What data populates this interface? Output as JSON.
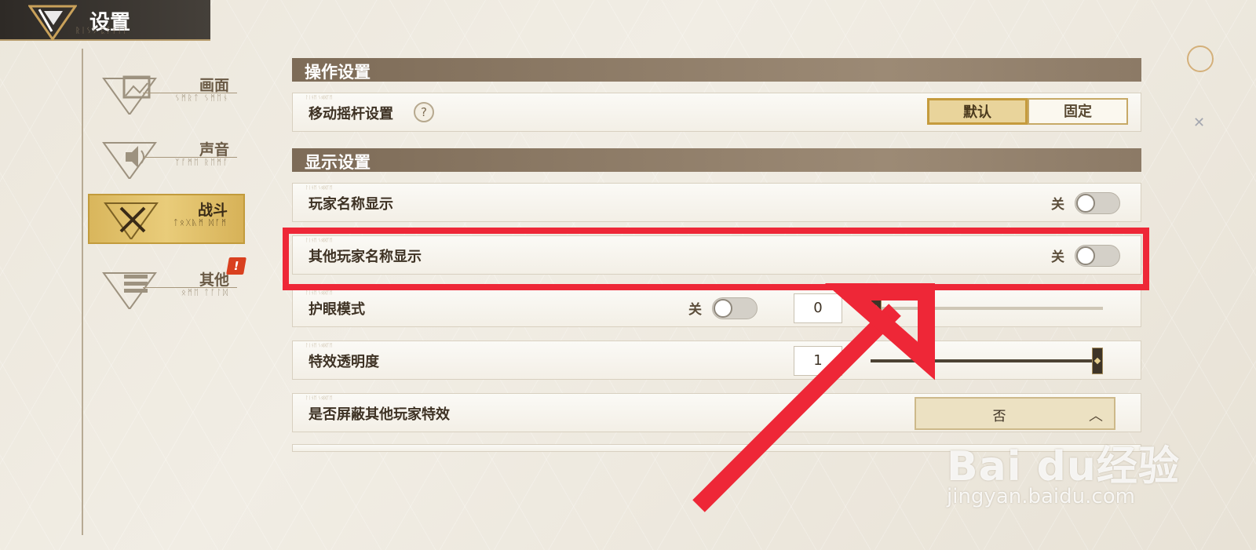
{
  "header": {
    "title": "设置"
  },
  "sidebar": {
    "items": [
      {
        "label": "画面",
        "icon": "picture-icon",
        "active": false
      },
      {
        "label": "声音",
        "icon": "sound-icon",
        "active": false
      },
      {
        "label": "战斗",
        "icon": "crossed-swords-icon",
        "active": true
      },
      {
        "label": "其他",
        "icon": "list-icon",
        "active": false,
        "badge": "!"
      }
    ]
  },
  "sections": {
    "operation": {
      "title": "操作设置",
      "joystick": {
        "label": "移动摇杆设置",
        "help": "?",
        "options": [
          "默认",
          "固定"
        ],
        "selected": "默认"
      }
    },
    "display": {
      "title": "显示设置",
      "player_names": {
        "label": "玩家名称显示",
        "state": "关"
      },
      "other_player_names": {
        "label": "其他玩家名称显示",
        "state": "关"
      },
      "eye_protection": {
        "label": "护眼模式",
        "state": "关",
        "value": "0",
        "level": 0
      },
      "effect_opacity": {
        "label": "特效透明度",
        "value": "1",
        "level": 1
      },
      "block_effects": {
        "label": "是否屏蔽其他玩家特效",
        "value": "否"
      }
    }
  },
  "watermark": {
    "brand": "Bai du经验",
    "url": "jingyan.baidu.com"
  },
  "colors": {
    "highlight": "#ee2737",
    "accent_gold": "#d9b65c",
    "section_bar": "#7d6b57"
  }
}
